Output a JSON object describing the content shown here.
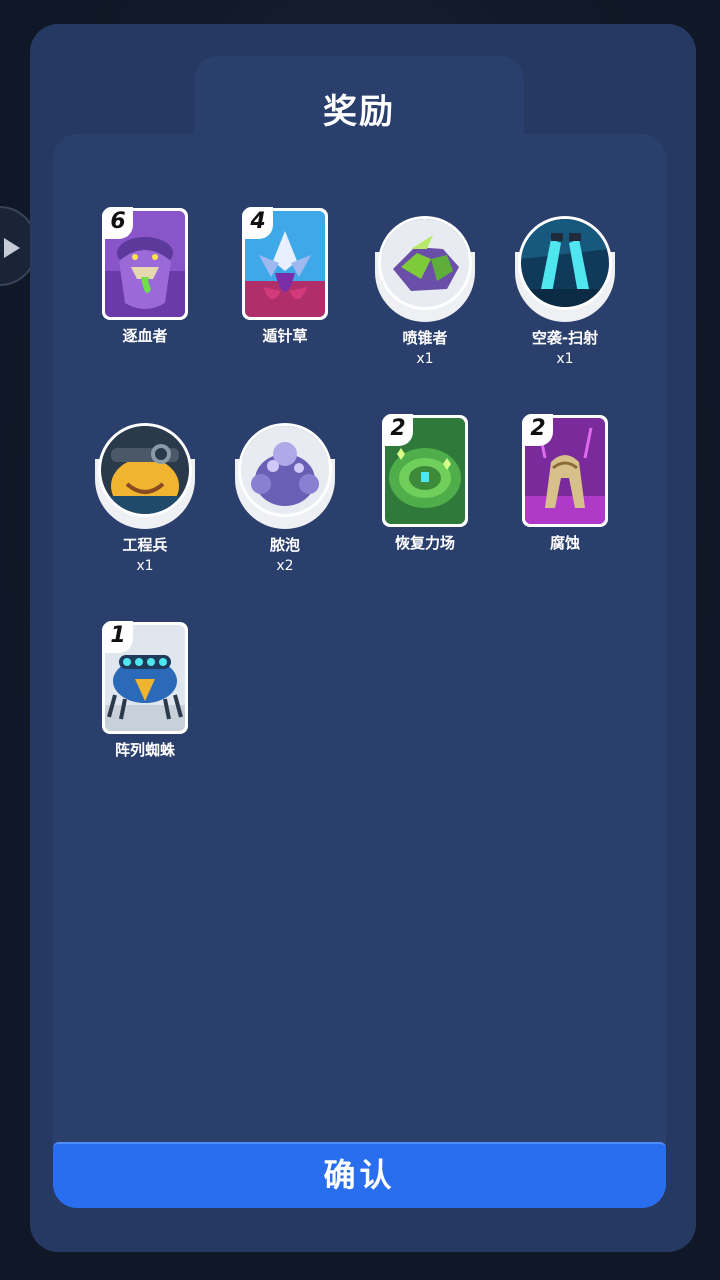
{
  "dialog": {
    "title": "奖励",
    "confirm_label": "确认"
  },
  "rewards": [
    {
      "name": "逐血者",
      "kind": "card",
      "cost": "6",
      "quantity": "",
      "icon": "purple-beast-card",
      "accent": "#7a3fbf"
    },
    {
      "name": "遁针草",
      "kind": "card",
      "cost": "4",
      "quantity": "",
      "icon": "crystal-plant-card",
      "accent": "#3aa0e0"
    },
    {
      "name": "喷锥者",
      "kind": "orb",
      "cost": "",
      "quantity": "x1",
      "icon": "green-rock-orb",
      "accent": "#5fae3a"
    },
    {
      "name": "空袭-扫射",
      "kind": "orb",
      "cost": "",
      "quantity": "x1",
      "icon": "airstrike-orb",
      "accent": "#1fb8d8"
    },
    {
      "name": "工程兵",
      "kind": "orb",
      "cost": "",
      "quantity": "x1",
      "icon": "engineer-orb",
      "accent": "#f0b430"
    },
    {
      "name": "脓泡",
      "kind": "orb",
      "cost": "",
      "quantity": "x2",
      "icon": "pus-blob-orb",
      "accent": "#6a5fb5"
    },
    {
      "name": "恢复力场",
      "kind": "card",
      "cost": "2",
      "quantity": "",
      "icon": "heal-field-card",
      "accent": "#3d9a4a"
    },
    {
      "name": "腐蚀",
      "kind": "card",
      "cost": "2",
      "quantity": "",
      "icon": "corrosion-card",
      "accent": "#9b2fb5"
    },
    {
      "name": "阵列蜘蛛",
      "kind": "card",
      "cost": "1",
      "quantity": "",
      "icon": "array-spider-card",
      "accent": "#2a7fd0"
    }
  ]
}
